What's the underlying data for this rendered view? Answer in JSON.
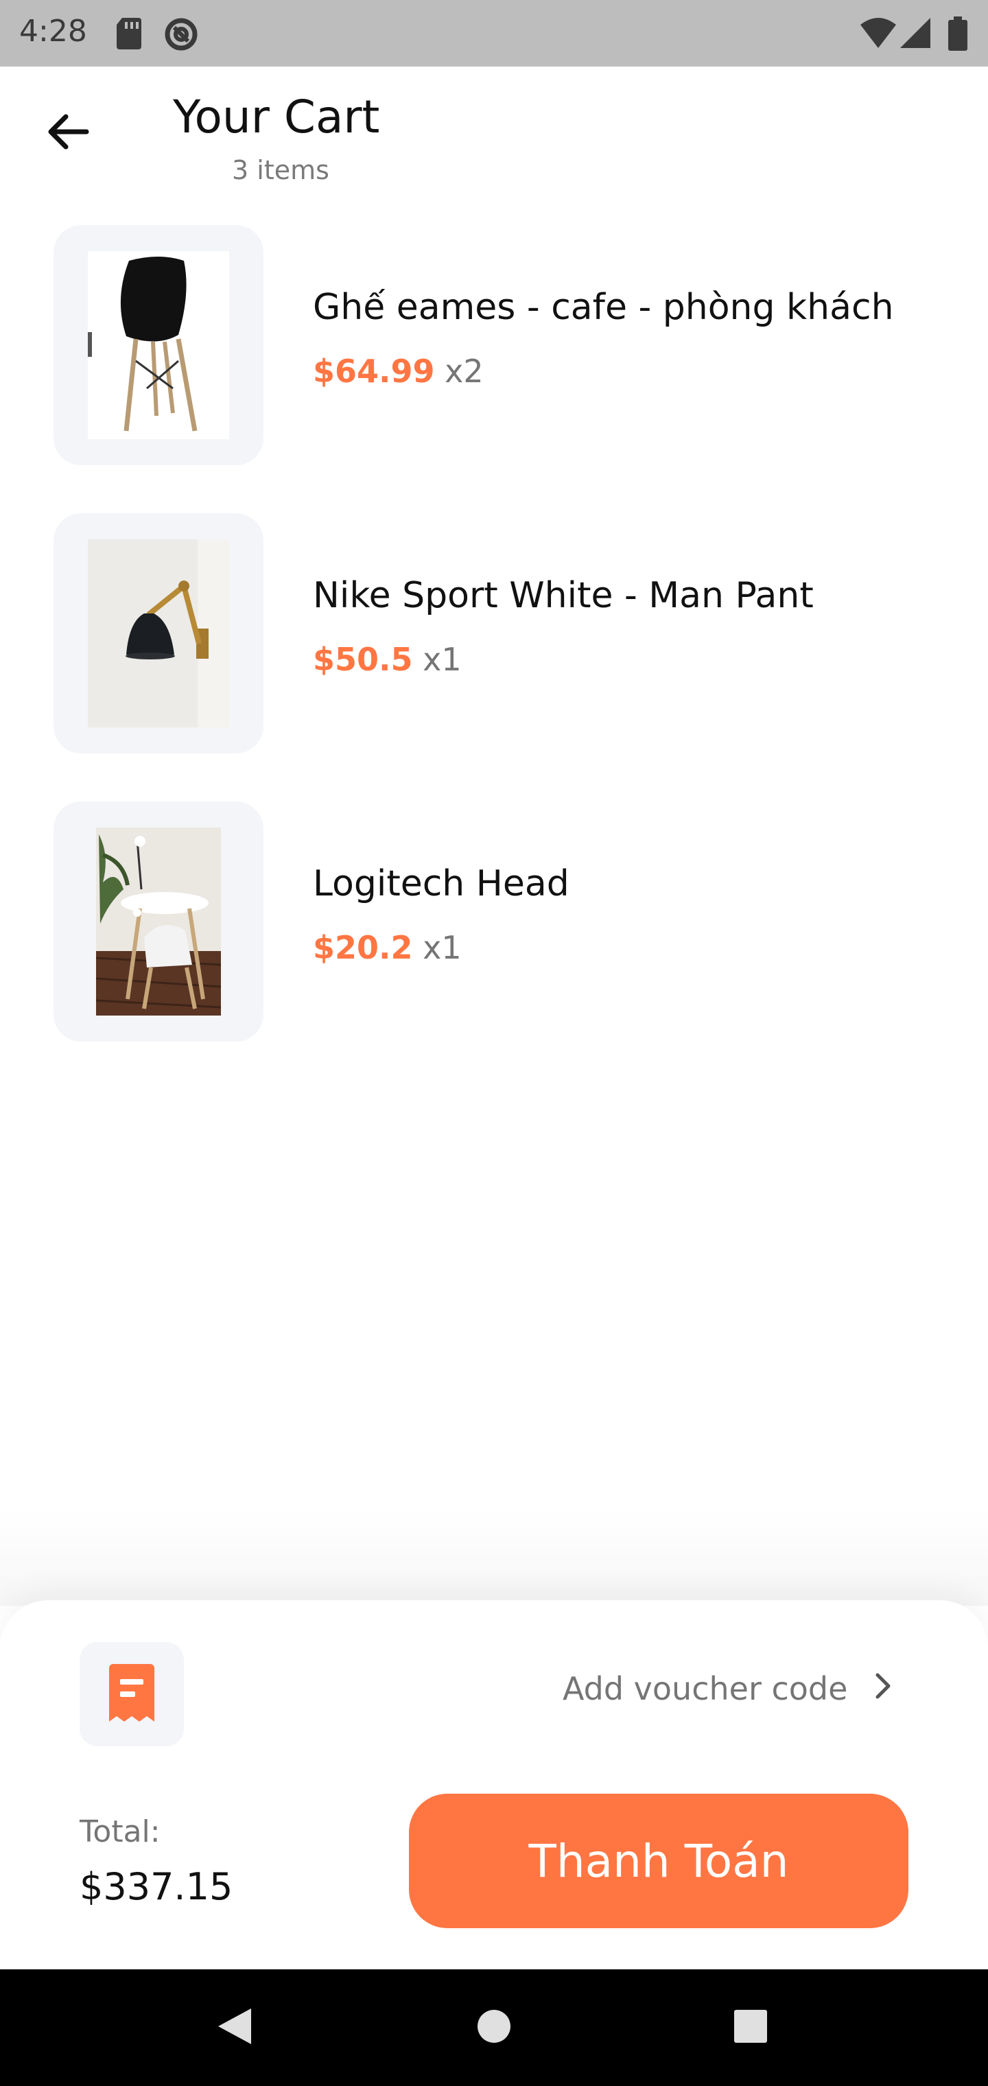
{
  "status_bar": {
    "time": "4:28",
    "icons": [
      "sd-card-icon",
      "sync-icon",
      "wifi-icon",
      "signal-icon",
      "battery-icon"
    ]
  },
  "header": {
    "title": "Your Cart",
    "subtitle": "3 items",
    "back_icon": "arrow-left-icon"
  },
  "cart": {
    "items": [
      {
        "name": "Ghế eames - cafe - phòng khách",
        "price": "$64.99",
        "qty": "x2",
        "image": "black eames chair"
      },
      {
        "name": "Nike Sport White - Man Pant",
        "price": "$50.5",
        "qty": "x1",
        "image": "black wall lamp"
      },
      {
        "name": "Logitech Head",
        "price": "$20.2",
        "qty": "x1",
        "image": "white cafe chairs and table"
      }
    ]
  },
  "voucher": {
    "icon": "receipt-icon",
    "label": "Add voucher code",
    "chevron": "chevron-right-icon"
  },
  "summary": {
    "total_label": "Total:",
    "total_value": "$337.15",
    "checkout_label": "Thanh Toán"
  },
  "colors": {
    "accent": "#ff7643",
    "card_bg": "#f4f5f9",
    "status_bar": "#bdbdbd",
    "nav_bar": "#000000"
  }
}
